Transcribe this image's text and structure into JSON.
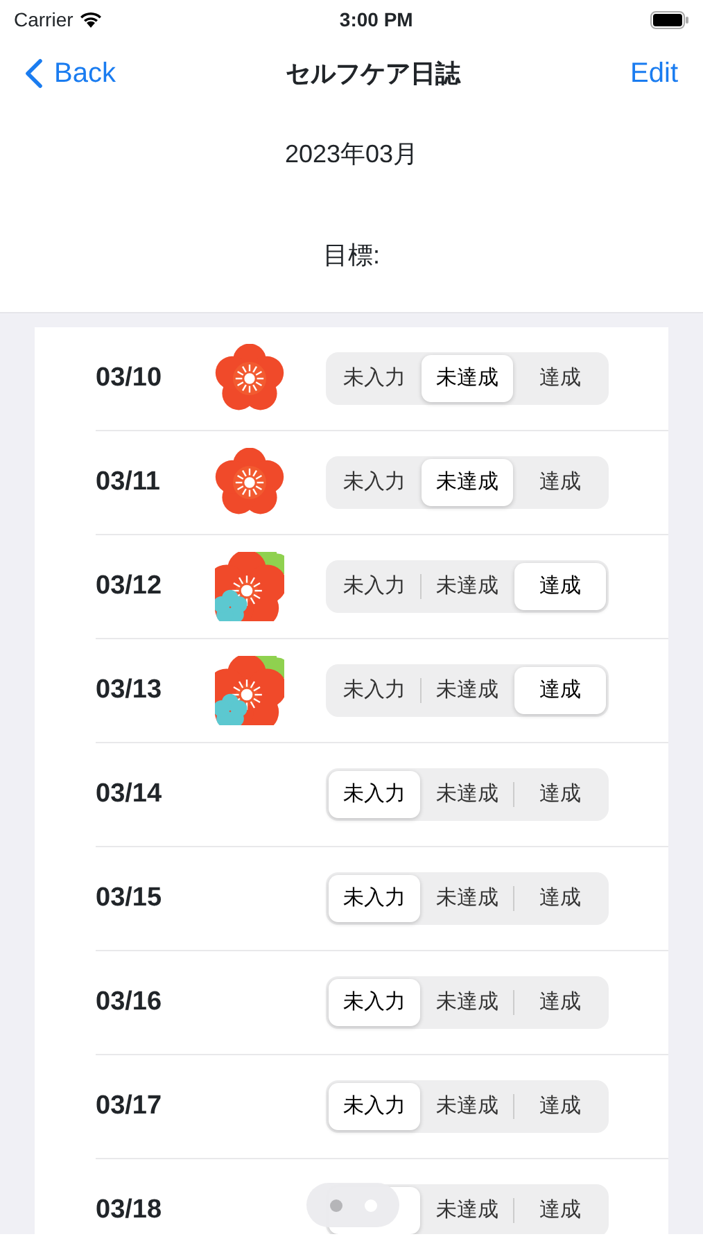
{
  "status_bar": {
    "carrier": "Carrier",
    "time": "3:00 PM"
  },
  "nav": {
    "back": "Back",
    "title": "セルフケア日誌",
    "action": "Edit"
  },
  "month": "2023年03月",
  "goal": "目標:",
  "rows": [
    {
      "date": "03/10",
      "kind": "flower",
      "options": [
        {
          "label": "未入力",
          "selected": false
        },
        {
          "label": "未達成",
          "selected": true
        },
        {
          "label": "達成",
          "selected": false
        }
      ]
    },
    {
      "date": "03/11",
      "kind": "flower",
      "options": [
        {
          "label": "未入力",
          "selected": false
        },
        {
          "label": "未達成",
          "selected": true
        },
        {
          "label": "達成",
          "selected": false
        }
      ]
    },
    {
      "date": "03/12",
      "kind": "bouquet",
      "options": [
        {
          "label": "未入力",
          "selected": false
        },
        {
          "label": "未達成",
          "selected": false
        },
        {
          "label": "達成",
          "selected": true
        }
      ]
    },
    {
      "date": "03/13",
      "kind": "bouquet",
      "options": [
        {
          "label": "未入力",
          "selected": false
        },
        {
          "label": "未達成",
          "selected": false
        },
        {
          "label": "達成",
          "selected": true
        }
      ]
    },
    {
      "date": "03/14",
      "options": [
        {
          "label": "未入力",
          "selected": true
        },
        {
          "label": "未達成",
          "selected": false
        },
        {
          "label": "達成",
          "selected": false
        }
      ]
    },
    {
      "date": "03/15",
      "options": [
        {
          "label": "未入力",
          "selected": true
        },
        {
          "label": "未達成",
          "selected": false
        },
        {
          "label": "達成",
          "selected": false
        }
      ]
    },
    {
      "date": "03/16",
      "options": [
        {
          "label": "未入力",
          "selected": true
        },
        {
          "label": "未達成",
          "selected": false
        },
        {
          "label": "達成",
          "selected": false
        }
      ]
    },
    {
      "date": "03/17",
      "options": [
        {
          "label": "未入力",
          "selected": true
        },
        {
          "label": "未達成",
          "selected": false
        },
        {
          "label": "達成",
          "selected": false
        }
      ]
    },
    {
      "date": "03/18",
      "options": [
        {
          "selected": true
        },
        {
          "label": "未達成",
          "selected": false
        },
        {
          "label": "達成",
          "selected": false
        }
      ]
    }
  ],
  "page_dots": [
    {
      "selected": true
    },
    {
      "selected": false
    }
  ]
}
